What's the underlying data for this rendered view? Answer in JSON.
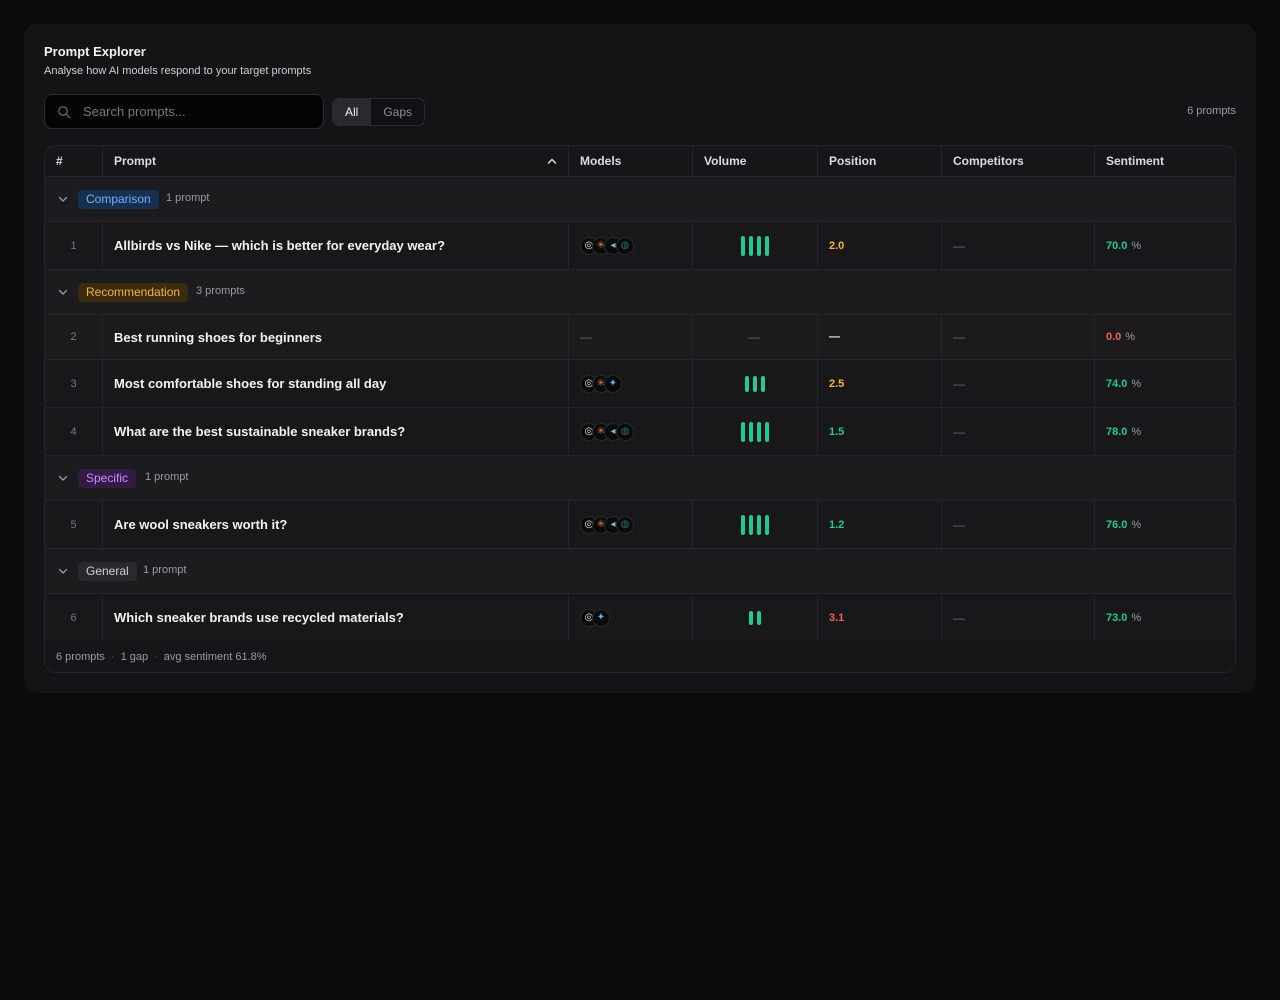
{
  "header": {
    "title": "Prompt Explorer",
    "subtitle": "Analyse how AI models respond to your target prompts"
  },
  "search": {
    "placeholder": "Search prompts...",
    "value": ""
  },
  "filters": {
    "all": "All",
    "gaps": "Gaps",
    "active": "all"
  },
  "prompt_count": "6 prompts",
  "columns": [
    "#",
    "Prompt",
    "Models",
    "Volume",
    "Position",
    "Competitors",
    "Sentiment"
  ],
  "groups": [
    {
      "name": "Comparison",
      "count": "1 prompt",
      "rows": [
        {
          "num": "1",
          "prompt": "Allbirds vs Nike — which is better for everyday wear?",
          "models": [
            "chatgpt-icon",
            "claude-icon",
            "perplexity-icon",
            "deepseek-icon"
          ],
          "volume": 4,
          "position": "2.0",
          "competitors": "—",
          "sentiment": "70.0",
          "pct": "%"
        }
      ]
    },
    {
      "name": "Recommendation",
      "count": "3 prompts",
      "rows": [
        {
          "num": "2",
          "prompt": "Best running shoes for beginners",
          "models_text": "—",
          "volume_text": "—",
          "position": "—",
          "competitors": "—",
          "sentiment": "0.0",
          "pct": "%"
        },
        {
          "num": "3",
          "prompt": "Most comfortable shoes for standing all day",
          "models": [
            "chatgpt-icon",
            "claude-icon",
            "gemini-icon"
          ],
          "volume": 3,
          "position": "2.5",
          "competitors": "—",
          "sentiment": "74.0",
          "pct": "%"
        },
        {
          "num": "4",
          "prompt": "What are the best sustainable sneaker brands?",
          "models": [
            "chatgpt-icon",
            "claude-icon",
            "perplexity-icon",
            "deepseek-icon"
          ],
          "volume": 4,
          "position": "1.5",
          "competitors": "—",
          "sentiment": "78.0",
          "pct": "%"
        }
      ]
    },
    {
      "name": "Specific",
      "count": "1 prompt",
      "rows": [
        {
          "num": "5",
          "prompt": "Are wool sneakers worth it?",
          "models": [
            "chatgpt-icon",
            "claude-icon",
            "perplexity-icon",
            "deepseek-icon"
          ],
          "volume": 4,
          "position": "1.2",
          "competitors": "—",
          "sentiment": "76.0",
          "pct": "%"
        }
      ]
    },
    {
      "name": "General",
      "count": "1 prompt",
      "rows": [
        {
          "num": "6",
          "prompt": "Which sneaker brands use recycled materials?",
          "models": [
            "chatgpt-icon",
            "gemini-icon"
          ],
          "volume": 2,
          "position": "3.1",
          "competitors": "—",
          "sentiment": "73.0",
          "pct": "%"
        }
      ]
    }
  ],
  "footer": {
    "prompts": "6 prompts",
    "sep": "·",
    "gaps": "1 gap",
    "avg": "avg sentiment 61.8%"
  },
  "colors": {
    "good": "#22c993",
    "warn": "#f5b43f",
    "bad": "#f25f5c",
    "neutral": "#f2f2f4"
  }
}
